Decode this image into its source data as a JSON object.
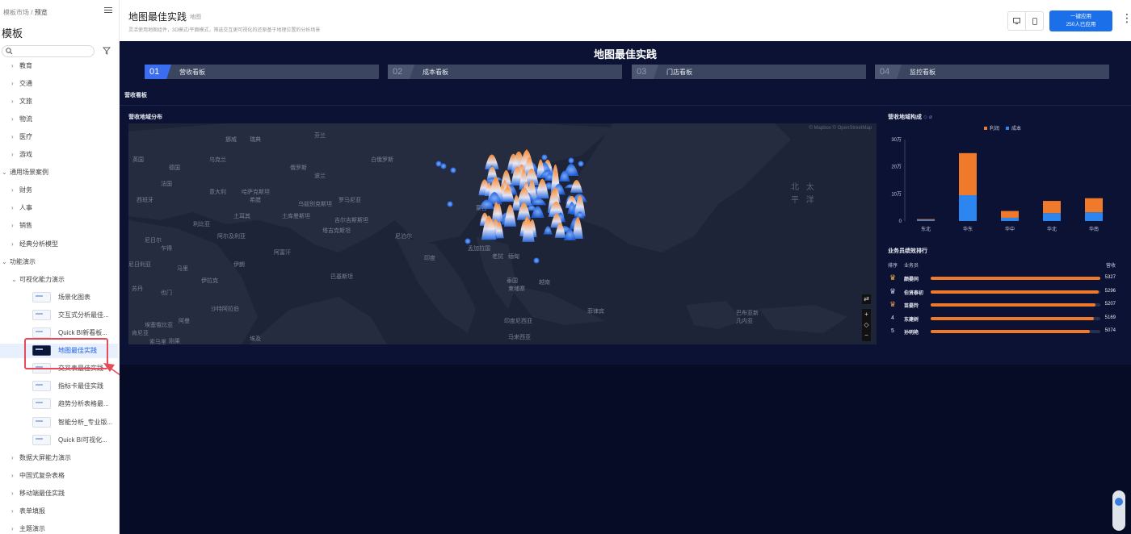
{
  "sidebar": {
    "breadcrumb": {
      "parent": "模板市场",
      "sep": "/",
      "current": "预览"
    },
    "title": "模板",
    "search": {
      "placeholder": ""
    },
    "items": [
      {
        "label": "教育",
        "kind": "sub"
      },
      {
        "label": "交通",
        "kind": "sub"
      },
      {
        "label": "文旅",
        "kind": "sub"
      },
      {
        "label": "物流",
        "kind": "sub"
      },
      {
        "label": "医疗",
        "kind": "sub"
      },
      {
        "label": "游戏",
        "kind": "sub"
      },
      {
        "label": "通用场景案例",
        "kind": "group"
      },
      {
        "label": "财务",
        "kind": "sub"
      },
      {
        "label": "人事",
        "kind": "sub"
      },
      {
        "label": "销售",
        "kind": "sub"
      },
      {
        "label": "经典分析模型",
        "kind": "sub"
      },
      {
        "label": "功能演示",
        "kind": "group"
      },
      {
        "label": "可视化能力演示",
        "kind": "sub-open"
      },
      {
        "label": "场景化图表",
        "kind": "leaf"
      },
      {
        "label": "交互式分析最佳...",
        "kind": "leaf"
      },
      {
        "label": "Quick BI新看板...",
        "kind": "leaf"
      },
      {
        "label": "地图最佳实践",
        "kind": "leaf-active"
      },
      {
        "label": "交叉表最佳实践",
        "kind": "leaf"
      },
      {
        "label": "指标卡最佳实践",
        "kind": "leaf"
      },
      {
        "label": "趋势分析表格最...",
        "kind": "leaf"
      },
      {
        "label": "智能分析_专业版...",
        "kind": "leaf"
      },
      {
        "label": "Quick BI可视化...",
        "kind": "leaf"
      },
      {
        "label": "数据大屏能力演示",
        "kind": "sub"
      },
      {
        "label": "中国式复杂表格",
        "kind": "sub"
      },
      {
        "label": "移动端最佳实践",
        "kind": "sub"
      },
      {
        "label": "表单填报",
        "kind": "sub"
      },
      {
        "label": "主题演示",
        "kind": "sub"
      }
    ]
  },
  "header": {
    "title": "地图最佳实践",
    "tag": "地图",
    "description": "灵活使用地图组件，3D模式/平面模式，筛选交互更可视化的还原基于地理位置的分析场景",
    "apply_button": {
      "line1": "一键应用",
      "line2": "250人已应用"
    },
    "more": "⋮"
  },
  "dashboard": {
    "title": "地图最佳实践",
    "tabs": [
      {
        "num": "01",
        "label": "营收看板",
        "active": true
      },
      {
        "num": "02",
        "label": "成本看板",
        "active": false
      },
      {
        "num": "03",
        "label": "门店看板",
        "active": false
      },
      {
        "num": "04",
        "label": "监控看板",
        "active": false
      }
    ],
    "section_label": "营收看板",
    "map": {
      "title": "营收地域分布",
      "copyright": "© Mapbox © OpenStreetMap",
      "labels": [
        "北 太",
        "平 洋",
        "巴布亚新",
        "几内亚",
        "印度尼西亚",
        "菲律宾",
        "泰国",
        "越南",
        "孟加拉国",
        "印度",
        "巴基斯坦",
        "阿富汗",
        "伊朗",
        "伊拉克",
        "沙特阿拉伯",
        "阿曼",
        "也门",
        "苏丹",
        "埃塞俄比亚",
        "索马里",
        "肯尼亚",
        "坦桑尼亚",
        "哈萨克斯坦",
        "蒙古",
        "俄罗斯",
        "乌克兰",
        "土耳其",
        "埃及",
        "利比亚",
        "乍得",
        "尼日尔",
        "马里",
        "阿尔及利亚",
        "尼日利亚",
        "刚果",
        "安哥拉",
        "赞比亚",
        "土库曼斯坦",
        "乌兹别克斯坦",
        "吉尔吉斯斯坦",
        "塔吉克斯坦",
        "缅甸",
        "老挝",
        "柬埔寨",
        "马来西亚",
        "尼泊尔",
        "波兰",
        "德国",
        "法国",
        "西班牙",
        "英国",
        "瑞典",
        "芬兰",
        "挪威",
        "白俄罗斯",
        "罗马尼亚",
        "希腊",
        "意大利"
      ],
      "controls": [
        "⇄",
        "+",
        "◇",
        "−"
      ]
    },
    "chart": {
      "title": "营收地域构成",
      "title_icons": "⬦ ⌀"
    },
    "chart_data": {
      "type": "bar",
      "title": "营收地域构成",
      "categories": [
        "东北",
        "华东",
        "华中",
        "华北",
        "华南"
      ],
      "series": [
        {
          "name": "利润",
          "color": "#ef7a2b",
          "values": [
            0.3,
            15.5,
            2.5,
            4.5,
            5.2
          ]
        },
        {
          "name": "成本",
          "color": "#2d86f0",
          "values": [
            0.4,
            9.5,
            1.2,
            2.9,
            3.2
          ]
        }
      ],
      "stacked": true,
      "yticks": [
        "0",
        "10万",
        "20万",
        "30万"
      ],
      "ylim": [
        0,
        30
      ],
      "legend": "top-right"
    },
    "ranking": {
      "title": "业务员绩效排行",
      "col_rank": "排序",
      "col_name": "业务员",
      "col_value": "营收",
      "rows": [
        {
          "rank": "1",
          "name": "颜晏同",
          "value": 5327,
          "pct": 100
        },
        {
          "rank": "2",
          "name": "伯贤泰初",
          "value": 5296,
          "pct": 99
        },
        {
          "rank": "3",
          "name": "苗晏羚",
          "value": 5207,
          "pct": 97
        },
        {
          "rank": "4",
          "name": "东建树",
          "value": 5169,
          "pct": 96
        },
        {
          "rank": "5",
          "name": "孙明艳",
          "value": 5074,
          "pct": 94
        }
      ]
    }
  }
}
